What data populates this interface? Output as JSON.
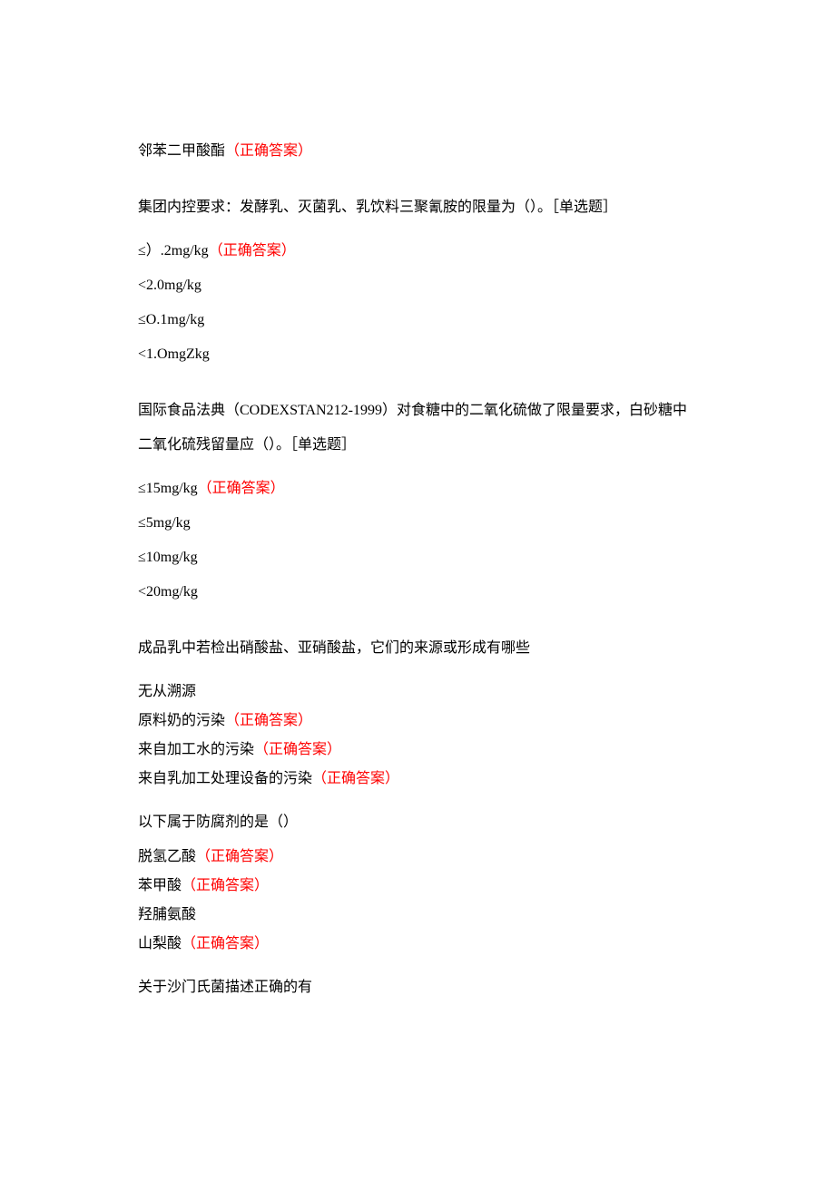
{
  "q1": {
    "optionText": "邻苯二甲酸酯",
    "correctLabel": "（正确答案）"
  },
  "q2": {
    "stemPrefix": "集团内控要求：发酵乳、灭菌乳、乳饮料三聚氰胺的限量为（）。",
    "typeTag": "［单选题］",
    "options": [
      {
        "text": "≤）.2mg/kg",
        "correct": true
      },
      {
        "text": "<2.0mg/kg",
        "correct": false
      },
      {
        "text": "≤O.1mg/kg",
        "correct": false
      },
      {
        "text": "<1.OmgZkg",
        "correct": false
      }
    ],
    "correctLabel": "（正确答案）"
  },
  "q3": {
    "stemLine1": "国际食品法典（CODEXSTAN212-1999）对食糖中的二氧化硫做了限量要求，白砂糖中",
    "stemLine2Prefix": "二氧化硫残留量应（）。",
    "typeTag": "［单选题］",
    "options": [
      {
        "text": "≤15mg/kg",
        "correct": true
      },
      {
        "text": "≤5mg/kg",
        "correct": false
      },
      {
        "text": "≤10mg/kg",
        "correct": false
      },
      {
        "text": "<20mg/kg",
        "correct": false
      }
    ],
    "correctLabel": "（正确答案）"
  },
  "q4": {
    "stem": "成品乳中若检出硝酸盐、亚硝酸盐，它们的来源或形成有哪些",
    "options": [
      {
        "text": "无从溯源",
        "correct": false
      },
      {
        "text": "原料奶的污染",
        "correct": true
      },
      {
        "text": "来自加工水的污染",
        "correct": true
      },
      {
        "text": "来自乳加工处理设备的污染",
        "correct": true
      }
    ],
    "correctLabel": "（正确答案）"
  },
  "q5": {
    "stem": "以下属于防腐剂的是（）",
    "options": [
      {
        "text": "脱氢乙酸",
        "correct": true
      },
      {
        "text": "苯甲酸",
        "correct": true
      },
      {
        "text": "羟脯氨酸",
        "correct": false
      },
      {
        "text": "山梨酸",
        "correct": true
      }
    ],
    "correctLabel": "（正确答案）"
  },
  "q6": {
    "stem": "关于沙门氏菌描述正确的有"
  }
}
